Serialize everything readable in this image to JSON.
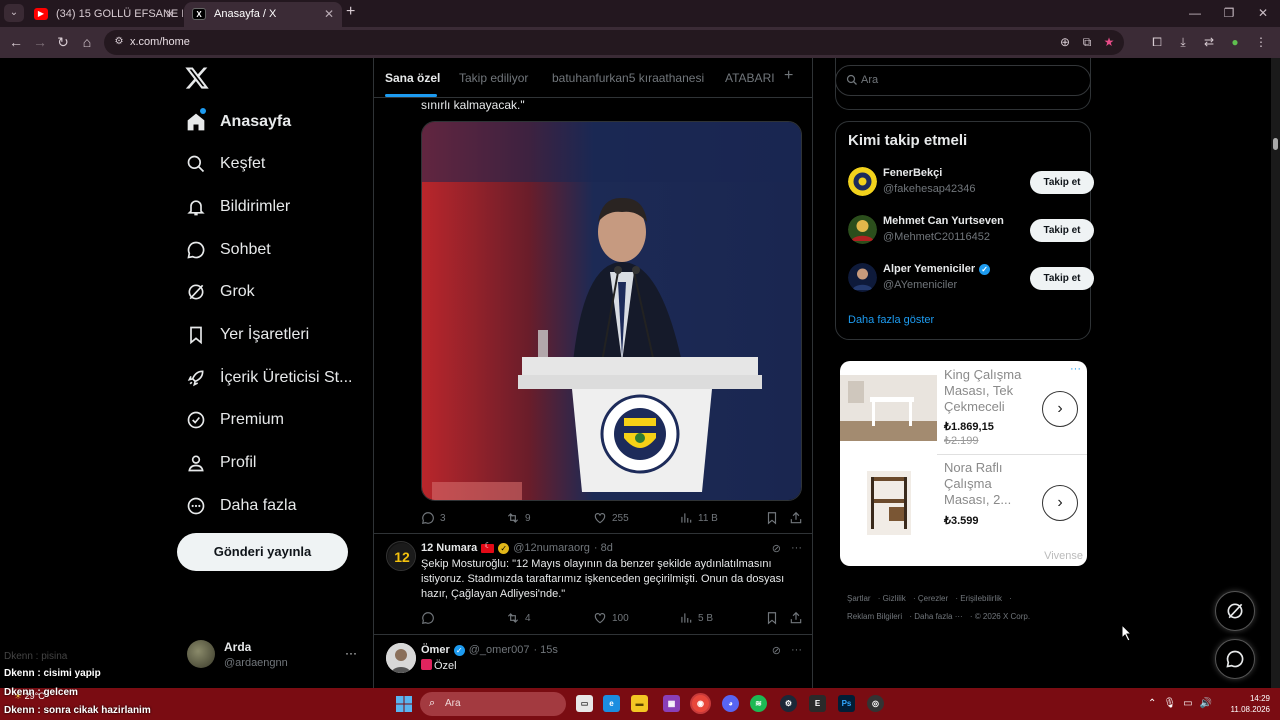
{
  "browser": {
    "tabs": [
      {
        "title": "(34) 15 GOLLÜ EFSANE MAÇ! K",
        "active": false,
        "favicon": "youtube-icon"
      },
      {
        "title": "Anasayfa / X",
        "active": true,
        "favicon": "x-icon"
      }
    ],
    "url": "x.com/home"
  },
  "nav": {
    "items": [
      {
        "label": "Anasayfa",
        "icon": "home-icon",
        "active": true
      },
      {
        "label": "Keşfet",
        "icon": "search-icon"
      },
      {
        "label": "Bildirimler",
        "icon": "bell-icon"
      },
      {
        "label": "Sohbet",
        "icon": "chat-icon"
      },
      {
        "label": "Grok",
        "icon": "grok-icon"
      },
      {
        "label": "Yer İşaretleri",
        "icon": "bookmark-icon"
      },
      {
        "label": "İçerik Üreticisi St...",
        "icon": "rocket-icon"
      },
      {
        "label": "Premium",
        "icon": "verified-icon"
      },
      {
        "label": "Profil",
        "icon": "person-icon"
      },
      {
        "label": "Daha fazla",
        "icon": "more-circle-icon"
      }
    ],
    "post_button": "Gönderi yayınla"
  },
  "account": {
    "name": "Arda",
    "handle": "@ardaengnn",
    "menu": "···"
  },
  "feed_tabs": [
    "Sana özel",
    "Takip ediliyor",
    "batuhanfurkan5 kıraathanesi",
    "ATABARI"
  ],
  "feed_tab_add": "+",
  "tweet1": {
    "cutoff_text": "sınırlı kalmayacak.\"",
    "stats": {
      "replies": "3",
      "reposts": "9",
      "likes": "255",
      "views": "11 B"
    }
  },
  "tweet2": {
    "avatar_text": "12",
    "name": "12 Numara",
    "handle": "@12numaraorg",
    "time": "· 8d",
    "text": "Şekip Mosturoğlu: \"12 Mayıs olayının da benzer şekilde aydınlatılmasını istiyoruz. Stadımızda taraftarımız işkenceden geçirilmişti. Onun da dosyası hazır, Çağlayan Adliyesi'nde.\"",
    "stats": {
      "replies": "",
      "reposts": "4",
      "likes": "100",
      "views": "5 B"
    }
  },
  "tweet3": {
    "name": "Ömer",
    "handle": "@_omer007",
    "time": "· 15s",
    "text": "Özel"
  },
  "right": {
    "search_placeholder": "Ara",
    "who_to_follow": {
      "title": "Kimi takip etmeli",
      "users": [
        {
          "name": "FenerBekçi",
          "handle": "@fakehesap42346",
          "verified": false
        },
        {
          "name": "Mehmet Can Yurtseven",
          "handle": "@MehmetC20116452",
          "verified": false
        },
        {
          "name": "Alper Yemeniciler",
          "handle": "@AYemeniciler",
          "verified": true
        }
      ],
      "follow_label": "Takip et",
      "show_more": "Daha fazla göster"
    },
    "ad": {
      "items": [
        {
          "title": "King Çalışma Masası, Tek Çekmeceli",
          "price": "₺1.869,15",
          "old_price": "₺2.199"
        },
        {
          "title": "Nora Raflı Çalışma Masası, 2...",
          "price": "₺3.599",
          "old_price": ""
        }
      ],
      "brand": "Vivense",
      "menu": "···"
    },
    "footer": [
      "Şartlar",
      "Gizlilik",
      "Çerezler",
      "Erişilebilirlik",
      "Reklam Bilgileri",
      "Daha fazla ···",
      "© 2026 X Corp."
    ]
  },
  "overlay_chat": [
    {
      "text": "Dkenn : pisina",
      "faded": true
    },
    {
      "text": "Dkenn : cisimi yapip",
      "faded": false
    },
    {
      "text": "Dkenn : gelcem",
      "faded": false
    },
    {
      "text": "Dkenn : sonra cikak hazirlanim",
      "faded": false
    }
  ],
  "taskbar": {
    "weather": "29°C",
    "search": "Ara",
    "time": "14:29",
    "date": "11.08.2026"
  },
  "colors": {
    "accent": "#1d9bf0",
    "background": "#000000",
    "taskbar": "#7a0c12"
  }
}
